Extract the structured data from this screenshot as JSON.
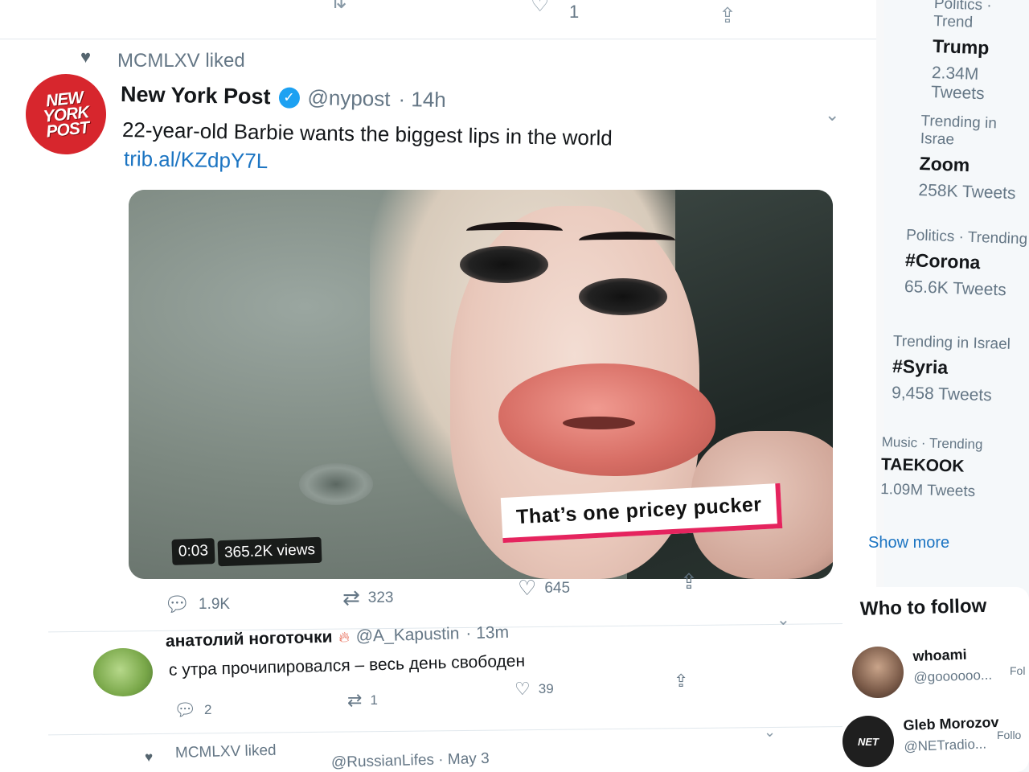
{
  "top_bar": {
    "like_count": "1"
  },
  "liked_header": "MCMLXV liked",
  "tweet": {
    "avatar_text": "NEW YORK POST",
    "name": "New York Post",
    "handle": "@nypost",
    "time": "· 14h",
    "text": "22-year-old Barbie wants the biggest lips in the world",
    "link": "trib.al/KZdpY7L",
    "media_caption": "That’s one pricey pucker",
    "video_time": "0:03",
    "video_views": "365.2K views",
    "replies": "1.9K",
    "retweets": "323",
    "likes": "645"
  },
  "reply_tweet": {
    "name": "анатолий ноготочки",
    "handle": "@A_Kapustin",
    "time": "· 13m",
    "text": "с утра прочипировался – весь день свободен",
    "replies": "2",
    "retweets": "1",
    "likes": "39"
  },
  "next_item": {
    "liked_header": "MCMLXV liked",
    "partial_text": "@RussianLifes · May 3"
  },
  "sidebar": {
    "trends": [
      {
        "category": "Politics · Trend",
        "name": "Trump",
        "count": "2.34M Tweets"
      },
      {
        "category": "Trending in Israe",
        "name": "Zoom",
        "count": "258K Tweets"
      },
      {
        "category": "Politics · Trending",
        "name": "#Corona",
        "count": "65.6K Tweets"
      },
      {
        "category": "Trending in Israel",
        "name": "#Syria",
        "count": "9,458 Tweets"
      },
      {
        "category": "Music · Trending",
        "name": "TAEKOOK",
        "count": "1.09M Tweets"
      }
    ],
    "show_more": "Show more",
    "who_to_follow": {
      "title": "Who to follow",
      "accounts": [
        {
          "name": "whoami",
          "handle": "@goooooo...",
          "button": "Fol"
        },
        {
          "name": "Gleb Morozov",
          "handle": "@NETradio...",
          "button": "Follo"
        }
      ]
    }
  },
  "colors": {
    "link": "#1b74c2",
    "verified": "#1da1f2",
    "caption_accent": "#e5245e",
    "nyp_red": "#d7262d"
  }
}
